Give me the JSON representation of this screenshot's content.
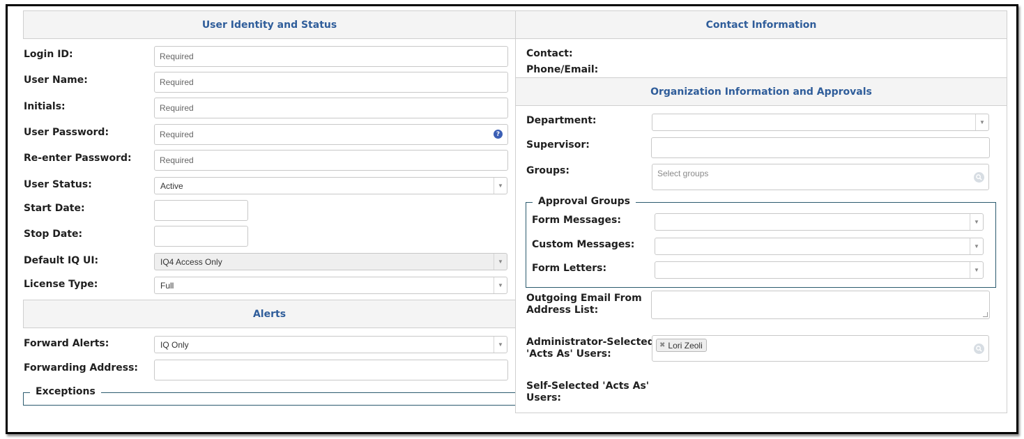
{
  "left": {
    "identity_header": "User Identity and Status",
    "login_id": {
      "label": "Login ID:",
      "placeholder": "Required"
    },
    "user_name": {
      "label": "User Name:",
      "placeholder": "Required"
    },
    "initials": {
      "label": "Initials:",
      "placeholder": "Required"
    },
    "user_password": {
      "label": "User Password:",
      "placeholder": "Required",
      "help_icon": "question-circle-icon"
    },
    "reenter_password": {
      "label": "Re-enter Password:",
      "placeholder": "Required"
    },
    "user_status": {
      "label": "User Status:",
      "value": "Active"
    },
    "start_date": {
      "label": "Start Date:",
      "value": ""
    },
    "stop_date": {
      "label": "Stop Date:",
      "value": ""
    },
    "default_iq_ui": {
      "label": "Default IQ UI:",
      "value": "IQ4 Access Only"
    },
    "license_type": {
      "label": "License Type:",
      "value": "Full"
    },
    "alerts_header": "Alerts",
    "forward_alerts": {
      "label": "Forward Alerts:",
      "value": "IQ Only"
    },
    "forwarding_address": {
      "label": "Forwarding Address:",
      "value": ""
    },
    "exceptions_legend": "Exceptions"
  },
  "right": {
    "contact_header": "Contact Information",
    "contact_label": "Contact:",
    "phone_email_label": "Phone/Email:",
    "org_header": "Organization Information and Approvals",
    "department": {
      "label": "Department:",
      "value": ""
    },
    "supervisor": {
      "label": "Supervisor:",
      "value": ""
    },
    "groups": {
      "label": "Groups:",
      "placeholder": "Select groups"
    },
    "approval_groups": {
      "legend": "Approval Groups",
      "form_messages": {
        "label": "Form Messages:",
        "value": ""
      },
      "custom_messages": {
        "label": "Custom Messages:",
        "value": ""
      },
      "form_letters": {
        "label": "Form Letters:",
        "value": ""
      }
    },
    "outgoing_email": {
      "label_line1": "Outgoing Email From",
      "label_line2": "Address List:",
      "value": ""
    },
    "admin_acts_as": {
      "label_line1": "Administrator-Selected",
      "label_line2": "'Acts As' Users:",
      "tags": [
        "Lori Zeoli"
      ]
    },
    "self_acts_as": {
      "label_line1": "Self-Selected 'Acts As'",
      "label_line2": "Users:"
    }
  },
  "icons": {
    "dropdown": "chevron-down-icon",
    "search": "search-icon",
    "remove": "close-icon"
  },
  "colors": {
    "header_text": "#2f5d9a",
    "header_bg": "#f4f4f4",
    "fieldset_border": "#2b5a6e"
  }
}
